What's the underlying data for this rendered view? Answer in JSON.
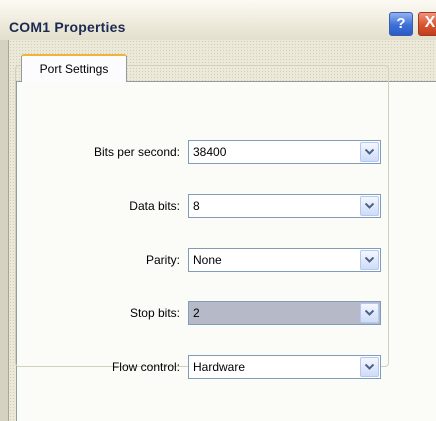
{
  "window": {
    "title": "COM1 Properties"
  },
  "title_buttons": {
    "help": "?",
    "close": "X"
  },
  "tabs": [
    {
      "label": "Port Settings"
    }
  ],
  "fields": [
    {
      "label": "Bits per second:",
      "value": "38400"
    },
    {
      "label": "Data bits:",
      "value": "8"
    },
    {
      "label": "Parity:",
      "value": "None"
    },
    {
      "label": "Stop bits:",
      "value": "2"
    },
    {
      "label": "Flow control:",
      "value": "Hardware"
    }
  ],
  "icons": {
    "dropdown_arrow": "chevron-down-icon",
    "help": "help-icon",
    "close": "close-icon"
  }
}
